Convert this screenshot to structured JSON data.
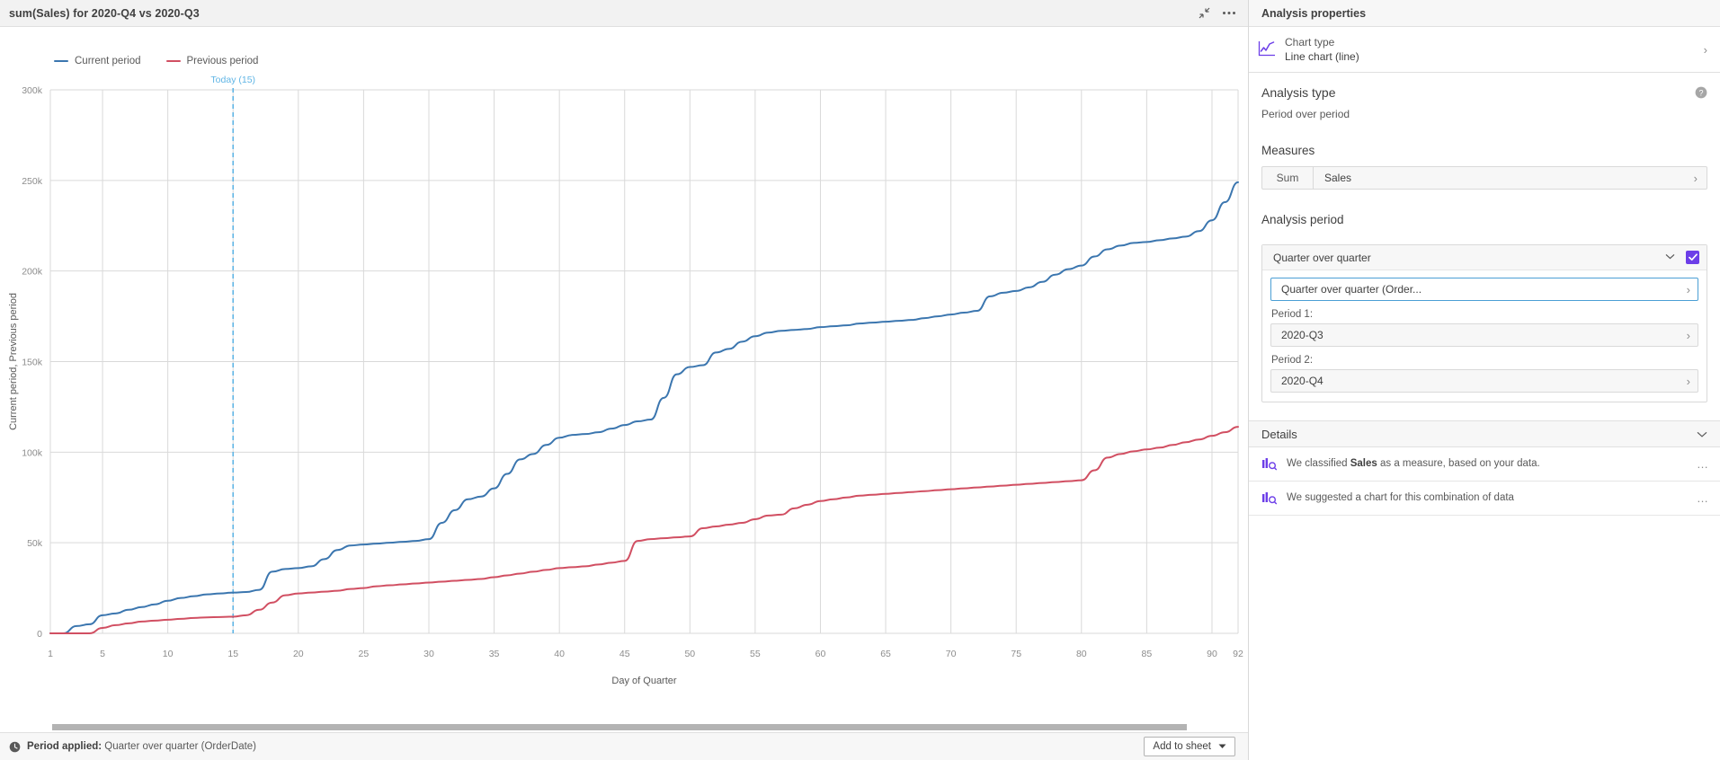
{
  "titlebar": {
    "title": "sum(Sales) for 2020-Q4 vs 2020-Q3",
    "minimize_icon": "collapse-icon",
    "more_icon": "more-options-icon"
  },
  "legend": {
    "items": [
      {
        "label": "Current period",
        "color": "#3b76af"
      },
      {
        "label": "Previous period",
        "color": "#d14f62"
      }
    ]
  },
  "chart_data": {
    "type": "line",
    "title": "sum(Sales) for 2020-Q4 vs 2020-Q3",
    "xlabel": "Day of Quarter",
    "ylabel": "Current period, Previous period",
    "xlim": [
      1,
      92
    ],
    "ylim": [
      0,
      300000
    ],
    "ytick_labels": [
      "0",
      "50k",
      "100k",
      "150k",
      "200k",
      "250k",
      "300k"
    ],
    "ytick_values": [
      0,
      50000,
      100000,
      150000,
      200000,
      250000,
      300000
    ],
    "xtick_labels": [
      "1",
      "5",
      "10",
      "15",
      "20",
      "25",
      "30",
      "35",
      "40",
      "45",
      "50",
      "55",
      "60",
      "65",
      "70",
      "75",
      "80",
      "85",
      "90",
      "92"
    ],
    "xtick_values": [
      1,
      5,
      10,
      15,
      20,
      25,
      30,
      35,
      40,
      45,
      50,
      55,
      60,
      65,
      70,
      75,
      80,
      85,
      90,
      92
    ],
    "grid": true,
    "legend_position": "top-left",
    "annotations": [
      {
        "label": "Today (15)",
        "x": 15,
        "color": "#60b5e5",
        "style": "dashed-vertical-line"
      }
    ],
    "series": [
      {
        "name": "Current period",
        "color": "#3b76af",
        "x": [
          1,
          2,
          3,
          4,
          5,
          6,
          7,
          8,
          9,
          10,
          11,
          12,
          13,
          14,
          15,
          16,
          17,
          18,
          19,
          20,
          21,
          22,
          23,
          24,
          25,
          26,
          27,
          28,
          29,
          30,
          31,
          32,
          33,
          34,
          35,
          36,
          37,
          38,
          39,
          40,
          41,
          42,
          43,
          44,
          45,
          46,
          47,
          48,
          49,
          50,
          51,
          52,
          53,
          54,
          55,
          56,
          57,
          58,
          59,
          60,
          61,
          62,
          63,
          64,
          65,
          66,
          67,
          68,
          69,
          70,
          71,
          72,
          73,
          74,
          75,
          76,
          77,
          78,
          79,
          80,
          81,
          82,
          83,
          84,
          85,
          86,
          87,
          88,
          89,
          90,
          91,
          92
        ],
        "values": [
          0,
          0,
          4000,
          5000,
          10000,
          11000,
          13000,
          14500,
          16000,
          18000,
          19500,
          20500,
          21500,
          22000,
          22500,
          22800,
          24000,
          34000,
          35500,
          36000,
          37000,
          41000,
          46000,
          48500,
          49000,
          49500,
          50000,
          50500,
          51000,
          52000,
          61000,
          68000,
          74000,
          75500,
          80000,
          88000,
          96000,
          99000,
          104000,
          108000,
          109500,
          110000,
          111000,
          113000,
          115000,
          117000,
          118000,
          130000,
          143000,
          147000,
          148000,
          155000,
          157000,
          161000,
          164000,
          166000,
          167000,
          167500,
          168000,
          169000,
          169500,
          170000,
          171000,
          171500,
          172000,
          172500,
          173000,
          174000,
          175000,
          176000,
          177000,
          178000,
          186000,
          188000,
          189000,
          191000,
          194000,
          198000,
          201000,
          203000,
          208000,
          212000,
          214000,
          215500,
          216000,
          217000,
          218000,
          219000,
          222000,
          228000,
          238000,
          249000
        ]
      },
      {
        "name": "Previous period",
        "color": "#d14f62",
        "x": [
          1,
          2,
          3,
          4,
          5,
          6,
          7,
          8,
          9,
          10,
          11,
          12,
          13,
          14,
          15,
          16,
          17,
          18,
          19,
          20,
          21,
          22,
          23,
          24,
          25,
          26,
          27,
          28,
          29,
          30,
          31,
          32,
          33,
          34,
          35,
          36,
          37,
          38,
          39,
          40,
          41,
          42,
          43,
          44,
          45,
          46,
          47,
          48,
          49,
          50,
          51,
          52,
          53,
          54,
          55,
          56,
          57,
          58,
          59,
          60,
          61,
          62,
          63,
          64,
          65,
          66,
          67,
          68,
          69,
          70,
          71,
          72,
          73,
          74,
          75,
          76,
          77,
          78,
          79,
          80,
          81,
          82,
          83,
          84,
          85,
          86,
          87,
          88,
          89,
          90,
          91,
          92
        ],
        "values": [
          0,
          0,
          0,
          0,
          3000,
          4500,
          5500,
          6500,
          7000,
          7500,
          8000,
          8500,
          8800,
          9000,
          9200,
          10000,
          13000,
          17000,
          21000,
          22000,
          22500,
          23000,
          23500,
          24500,
          25000,
          26000,
          26500,
          27000,
          27500,
          28000,
          28500,
          29000,
          29500,
          30000,
          31000,
          32000,
          33000,
          34000,
          35000,
          36000,
          36500,
          37000,
          38000,
          39000,
          40000,
          51000,
          52000,
          52500,
          53000,
          53500,
          58000,
          59000,
          60000,
          61000,
          63000,
          65000,
          65500,
          69000,
          71000,
          73000,
          74000,
          75000,
          76000,
          76500,
          77000,
          77500,
          78000,
          78500,
          79000,
          79500,
          80000,
          80500,
          81000,
          81500,
          82000,
          82500,
          83000,
          83500,
          84000,
          84500,
          90000,
          97000,
          99000,
          100500,
          101500,
          102500,
          104000,
          105500,
          107000,
          109000,
          111000,
          114000
        ]
      }
    ]
  },
  "scrollbar": {
    "name": "horizontal-scrollbar"
  },
  "statusbar": {
    "icon": "clock-icon",
    "prefix": "Period applied:",
    "value": "Quarter over quarter (OrderDate)",
    "add_to_sheet_label": "Add to sheet"
  },
  "panel": {
    "header": "Analysis properties",
    "chart_type": {
      "icon": "line-chart-icon",
      "label": "Chart type",
      "value": "Line chart (line)",
      "chevron": "chevron-right-icon"
    },
    "analysis_type": {
      "title": "Analysis type",
      "help_icon": "help-icon",
      "value": "Period over period"
    },
    "measures": {
      "title": "Measures",
      "aggregation": "Sum",
      "field": "Sales",
      "chevron": "chevron-right-icon"
    },
    "analysis_period": {
      "title": "Analysis period",
      "selected": "Quarter over quarter",
      "caret": "chevron-down-icon",
      "checkbox_checked": true,
      "accent": "#6c3ee8",
      "field": "Quarter over quarter (Order...",
      "period1_label": "Period 1:",
      "period1_value": "2020-Q3",
      "period2_label": "Period 2:",
      "period2_value": "2020-Q4"
    },
    "details": {
      "title": "Details",
      "collapse_icon": "chevron-down-icon",
      "items": [
        {
          "icon": "insight-icon",
          "text_pre": "We classified ",
          "text_bold": "Sales",
          "text_post": " as a measure, based on your data.",
          "menu": "…"
        },
        {
          "icon": "insight-icon",
          "text_pre": "We suggested a chart for this combination of data",
          "text_bold": "",
          "text_post": "",
          "menu": "…"
        }
      ]
    }
  }
}
